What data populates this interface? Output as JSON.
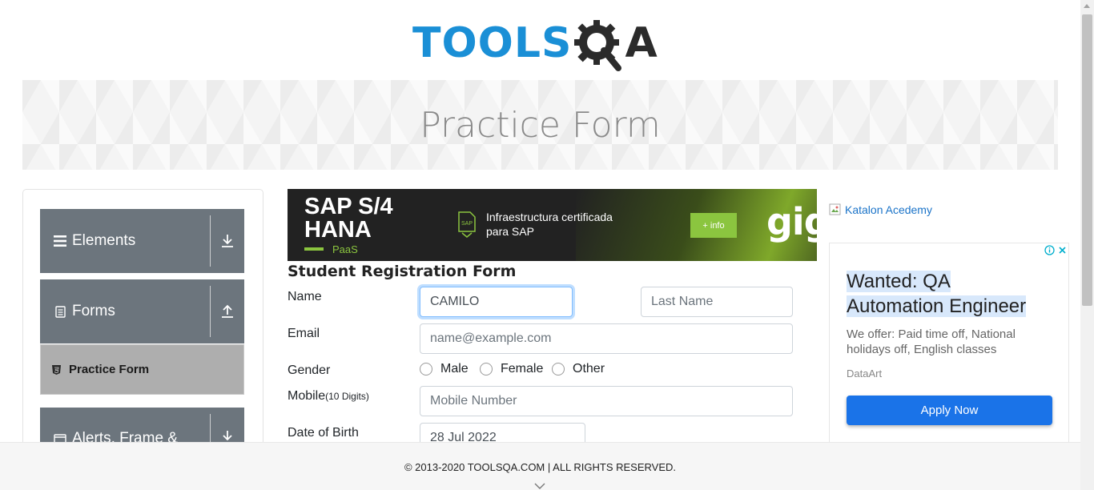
{
  "header": {
    "logo_tools": "TOOLS",
    "logo_qa": "A",
    "logo_q_hidden": "Q",
    "banner_title": "Practice Form"
  },
  "sidebar": {
    "groups": [
      {
        "label": "Elements",
        "icon": "hamburger-icon",
        "arrow": "download-arrow-icon"
      },
      {
        "label": "Forms",
        "icon": "document-icon",
        "arrow": "upload-arrow-icon"
      },
      {
        "label": "Alerts, Frame &",
        "icon": "browser-window-icon",
        "arrow": "download-arrow-icon"
      }
    ],
    "active_item": {
      "label": "Practice Form",
      "icon": "html5-icon"
    }
  },
  "ad_top": {
    "title_line1": "SAP S/4",
    "title_line2": "HANA",
    "subtitle": "PaaS",
    "sap_badge": "SAP",
    "desc_line1": "Infraestructura certificada",
    "desc_line2": "para SAP",
    "button": "+ info",
    "brand": "gig"
  },
  "form": {
    "title": "Student Registration Form",
    "name_label": "Name",
    "first_name_value": "CAMILO",
    "first_name_placeholder": "First Name",
    "last_name_placeholder": "Last Name",
    "email_label": "Email",
    "email_placeholder": "name@example.com",
    "gender_label": "Gender",
    "gender_options": [
      "Male",
      "Female",
      "Other"
    ],
    "mobile_label": "Mobile",
    "mobile_hint": "(10 Digits)",
    "mobile_placeholder": "Mobile Number",
    "dob_label": "Date of Birth",
    "dob_value": "28 Jul 2022"
  },
  "ad_right": {
    "link_text": "Katalon Acedemy",
    "headline_line1": "Wanted: QA",
    "headline_line2": "Automation Engineer",
    "description": "We offer: Paid time off, National holidays off, English classes",
    "source": "DataArt",
    "cta": "Apply Now"
  },
  "footer": {
    "copyright": "© 2013-2020 TOOLSQA.COM | ALL RIGHTS RESERVED."
  },
  "colors": {
    "brand_blue": "#1a8fd6",
    "sidebar_group": "#6c757d",
    "active_item": "#aeaeae",
    "ad_green": "#8bc53f",
    "apply_button": "#1a73e8"
  }
}
